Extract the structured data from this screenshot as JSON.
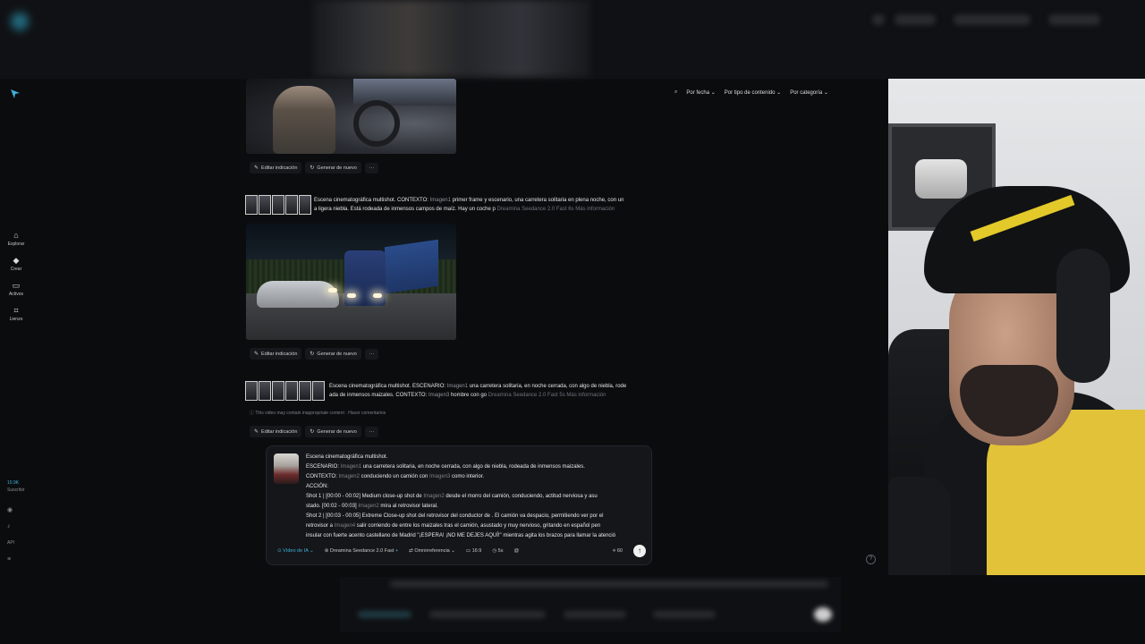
{
  "sidebar": {
    "items": [
      {
        "label": "Explorar",
        "icon": "home-icon"
      },
      {
        "label": "Crear",
        "icon": "sparkle-icon"
      },
      {
        "label": "Activos",
        "icon": "folder-icon"
      },
      {
        "label": "Lienzo",
        "icon": "canvas-icon"
      }
    ],
    "credits": "10.9K",
    "plan": "Suscribir",
    "api": "API"
  },
  "filters": {
    "date": "Por fecha",
    "content_type": "Por tipo de contenido",
    "category": "Por categoría"
  },
  "feed": {
    "item1": {
      "edit": "Editar indicación",
      "regenerate": "Generar de nuevo",
      "more": "···"
    },
    "item2": {
      "prompt_line1_a": "Escena cinematográfica multishot. CONTEXTO:",
      "prompt_line1_ref": "Imagen1",
      "prompt_line1_b": "primer frame y escenario, una carretera solitaria en plena noche, con un",
      "prompt_line2": "a ligera niebla. Está rodeada de inmensos campos de maíz. Hay un coche p",
      "model": "Dreamina Seedance 2.0 Fast",
      "duration": "6s",
      "more_info": "Más información",
      "edit": "Editar indicación",
      "regenerate": "Generar de nuevo",
      "more": "···"
    },
    "item3": {
      "prompt_line1_a": "Escena cinematográfica multishot. ESCENARIO:",
      "prompt_line1_ref": "Imagen1",
      "prompt_line1_b": "una carretera solitaria, en noche cerrada, con algo de niebla, rode",
      "prompt_line2_a": "ada de inmensos maizales. CONTEXTO:",
      "prompt_line2_ref": "Imagen3",
      "prompt_line2_b": "hombre con go",
      "model": "Dreamina Seedance 2.0 Fast",
      "duration": "5s",
      "more_info": "Más información",
      "warning": "This video may contain inappropriate content",
      "feedback": "Hacer comentarios",
      "edit": "Editar indicación",
      "regenerate": "Generar de nuevo",
      "more": "···"
    }
  },
  "composer": {
    "line1": "Escena cinematográfica multishot.",
    "line2_a": "ESCENARIO:",
    "line2_ref": "Imagen1",
    "line2_b": "una carretera solitaria, en noche cerrada, con algo de niebla, rodeada de inmensos maizales.",
    "line3_a": "CONTEXTO:",
    "line3_ref": "Imagen2",
    "line3_b": "conduciendo un camión con",
    "line3_ref2": "Imagen3",
    "line3_c": "como interior.",
    "line4": "ACCIÓN:",
    "line5_a": "Shot 1 | [00:00 - 00:02] Medium close-up shot de",
    "line5_ref": "Imagen2",
    "line5_b": "desde el morro del camión, conduciendo, actitud nerviosa y asu",
    "line6_a": "stado. [00:02 - 00:03]",
    "line6_ref": "Imagen2",
    "line6_b": "mira al retrovisor lateral.",
    "line7": "Shot 2 | [00:03 - 00:05] Extreme Close-up shot del retrovisor del conductor de . El camión va despacio, permitiendo ver por el",
    "line8_a": "retrovisor a",
    "line8_ref": "Imagen4",
    "line8_b": "salir corriendo de entre los maizales tras el camión, asustado y muy nervioso, gritando en español pen",
    "line9": "insular con fuerte acento castellano de Madrid \"¡ESPERA! ¡NO ME DEJES AQUÍ!\" mientras agita los brazos para llamar la atenció",
    "mode": "Vídeo de IA",
    "model": "Dreamina Seedance 2.0 Fast",
    "reference": "Omnirreferencia",
    "ratio": "16:9",
    "duration": "5s",
    "cost": "60"
  },
  "colors": {
    "accent": "#3fb0d8",
    "background": "#0b0c0e"
  }
}
